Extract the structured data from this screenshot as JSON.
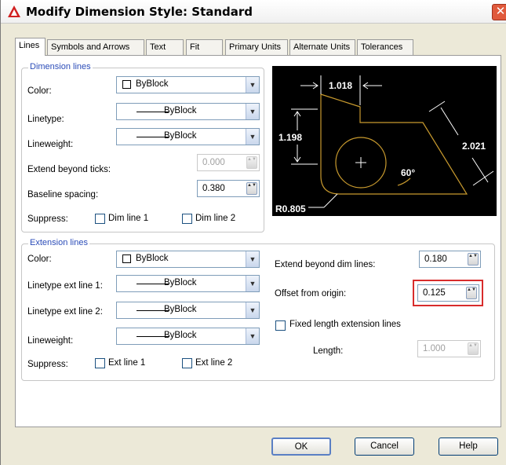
{
  "window": {
    "title": "Modify Dimension Style: Standard",
    "close_glyph": "✕"
  },
  "tabs": [
    "Lines",
    "Symbols and Arrows",
    "Text",
    "Fit",
    "Primary Units",
    "Alternate Units",
    "Tolerances"
  ],
  "dimension_lines": {
    "legend": "Dimension lines",
    "color_label": "Color:",
    "color_value": "ByBlock",
    "linetype_label": "Linetype:",
    "linetype_value": "ByBlock",
    "lineweight_label": "Lineweight:",
    "lineweight_value": "ByBlock",
    "extend_label": "Extend beyond ticks:",
    "extend_value": "0.000",
    "baseline_label": "Baseline spacing:",
    "baseline_value": "0.380",
    "suppress_label": "Suppress:",
    "dim_line_1": "Dim line 1",
    "dim_line_2": "Dim line 2"
  },
  "extension_lines": {
    "legend": "Extension lines",
    "color_label": "Color:",
    "color_value": "ByBlock",
    "lt1_label": "Linetype ext line 1:",
    "lt1_value": "ByBlock",
    "lt2_label": "Linetype ext line 2:",
    "lt2_value": "ByBlock",
    "lineweight_label": "Lineweight:",
    "lineweight_value": "ByBlock",
    "suppress_label": "Suppress:",
    "ext_line_1": "Ext line 1",
    "ext_line_2": "Ext line 2",
    "extend_beyond_label": "Extend beyond dim lines:",
    "extend_beyond_value": "0.180",
    "offset_label": "Offset from origin:",
    "offset_value": "0.125",
    "fixed_length_label": "Fixed length extension lines",
    "length_label": "Length:",
    "length_value": "1.000"
  },
  "preview": {
    "dim_top": "1.018",
    "dim_left": "1.198",
    "dim_right": "2.021",
    "angle": "60°",
    "radius": "R0.805"
  },
  "buttons": {
    "ok": "OK",
    "cancel": "Cancel",
    "help": "Help"
  },
  "icons": {
    "app": "autocad-triangle-icon",
    "dropdown": "▼",
    "spin": "▲▼"
  },
  "colors": {
    "preview_bg": "#000000",
    "preview_geometry": "#c89a2e",
    "highlight": "#d82c2c",
    "legend_text": "#2b4cb8"
  }
}
